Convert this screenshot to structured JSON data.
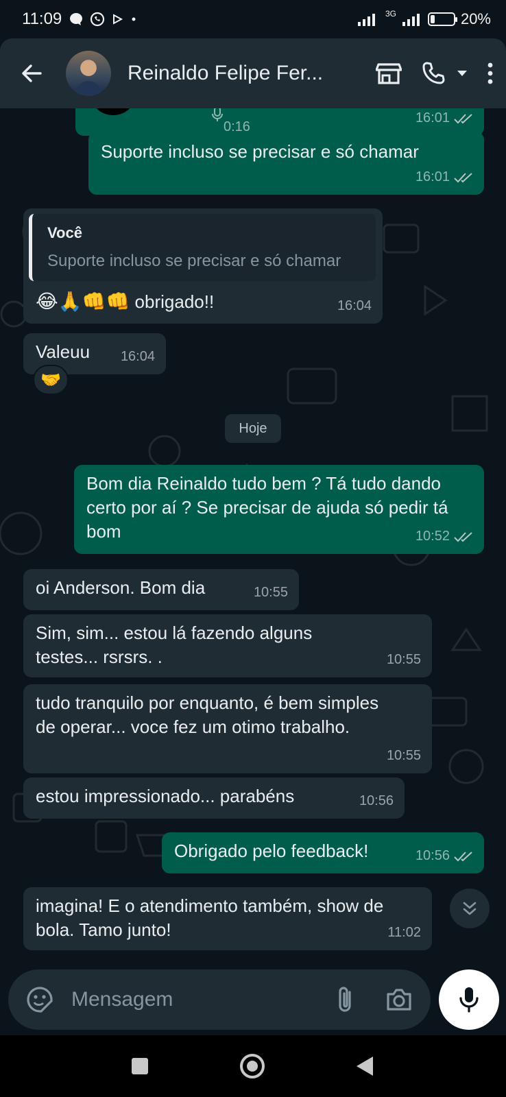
{
  "status_bar": {
    "time": "11:09",
    "network": "3G",
    "battery": "20%",
    "battery_level": 0.2
  },
  "header": {
    "contact_name": "Reinaldo Felipe Fer..."
  },
  "messages": [
    {
      "id": "m0",
      "direction": "out",
      "text": "",
      "duration": "0:16",
      "time": "16:01",
      "status": "read"
    },
    {
      "id": "m1",
      "direction": "out",
      "text": "Suporte incluso se precisar e só chamar",
      "time": "16:01",
      "status": "read"
    },
    {
      "id": "m2",
      "direction": "in",
      "quote_author": "Você",
      "quote_text": "Suporte incluso se precisar e só chamar",
      "emojis": "😂🙏👊👊",
      "text": "obrigado!!",
      "time": "16:04"
    },
    {
      "id": "m3",
      "direction": "in",
      "text": "Valeuu",
      "time": "16:04",
      "reaction": "🤝"
    },
    {
      "id": "m4",
      "direction": "out",
      "text": "Bom dia Reinaldo tudo bem ? Tá tudo dando certo por aí ? Se precisar de ajuda só pedir tá bom",
      "time": "10:52",
      "status": "read"
    },
    {
      "id": "m5",
      "direction": "in",
      "text": "oi Anderson. Bom dia",
      "time": "10:55"
    },
    {
      "id": "m6",
      "direction": "in",
      "text": "Sim, sim... estou lá fazendo alguns testes... rsrsrs. .",
      "time": "10:55"
    },
    {
      "id": "m7",
      "direction": "in",
      "text": "tudo tranquilo por enquanto, é bem simples de operar... voce fez um otimo trabalho.",
      "time": "10:55"
    },
    {
      "id": "m8",
      "direction": "in",
      "text": "estou impressionado... parabéns",
      "time": "10:56"
    },
    {
      "id": "m9",
      "direction": "out",
      "text": "Obrigado pelo feedback!",
      "time": "10:56",
      "status": "read"
    },
    {
      "id": "m10",
      "direction": "in",
      "text": "imagina! E o atendimento também, show de bola. Tamo junto!",
      "time": "11:02"
    }
  ],
  "date_separator": "Hoje",
  "composer": {
    "placeholder": "Mensagem"
  },
  "colors": {
    "background": "#0b141a",
    "incoming_bubble": "#1f2c34",
    "outgoing_bubble": "#005c4b",
    "header": "#1f2c34",
    "secondary_text": "#8696a0"
  },
  "icons": {
    "back": "arrow-left-icon",
    "store": "store-icon",
    "call": "phone-icon",
    "menu": "more-vert-icon",
    "emoji": "sticker-icon",
    "attach": "paperclip-icon",
    "camera": "camera-icon",
    "mic": "mic-icon",
    "scroll": "double-chevron-down-icon"
  }
}
